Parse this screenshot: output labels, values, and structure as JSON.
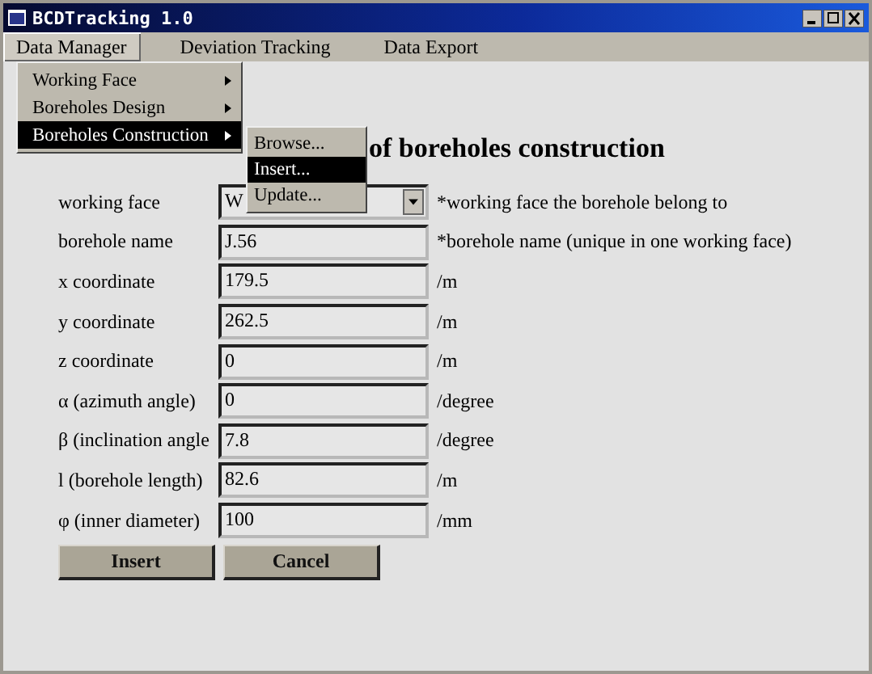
{
  "window": {
    "title": "BCDTracking 1.0"
  },
  "menu_bar": [
    {
      "label": "Data Manager",
      "selected": true
    },
    {
      "label": "Deviation Tracking",
      "selected": false
    },
    {
      "label": "Data Export",
      "selected": false
    }
  ],
  "menu": [
    {
      "label": "Working Face",
      "selected": false,
      "has_submenu": true
    },
    {
      "label": "Boreholes Design",
      "selected": false,
      "has_submenu": true
    },
    {
      "label": "Boreholes Construction",
      "selected": true,
      "has_submenu": true
    }
  ],
  "submenu": [
    {
      "label": "Browse...",
      "selected": false
    },
    {
      "label": "Insert...",
      "selected": true
    },
    {
      "label": "Update...",
      "selected": false
    }
  ],
  "heading": "of boreholes construction",
  "fields": [
    {
      "label": "working face",
      "kind": "combo",
      "value": "W",
      "note": "*working face the borehole belong to"
    },
    {
      "label": "borehole name",
      "kind": "text",
      "value": "J.56",
      "note": "*borehole name (unique in one working face)"
    },
    {
      "label": "x coordinate",
      "kind": "text",
      "value": "179.5",
      "note": "/m"
    },
    {
      "label": "y coordinate",
      "kind": "text",
      "value": "262.5",
      "note": "/m"
    },
    {
      "label": "z coordinate",
      "kind": "text",
      "value": "0",
      "note": "/m"
    },
    {
      "label": "α (azimuth angle)",
      "kind": "text",
      "value": "0",
      "note": "/degree"
    },
    {
      "label": "β (inclination angle",
      "kind": "text",
      "value": "7.8",
      "note": "/degree"
    },
    {
      "label": "l (borehole length)",
      "kind": "text",
      "value": "82.6",
      "note": "/m"
    },
    {
      "label": "φ (inner diameter)",
      "kind": "text",
      "value": "100",
      "note": "/mm"
    }
  ],
  "buttons": [
    "Insert",
    "Cancel"
  ]
}
